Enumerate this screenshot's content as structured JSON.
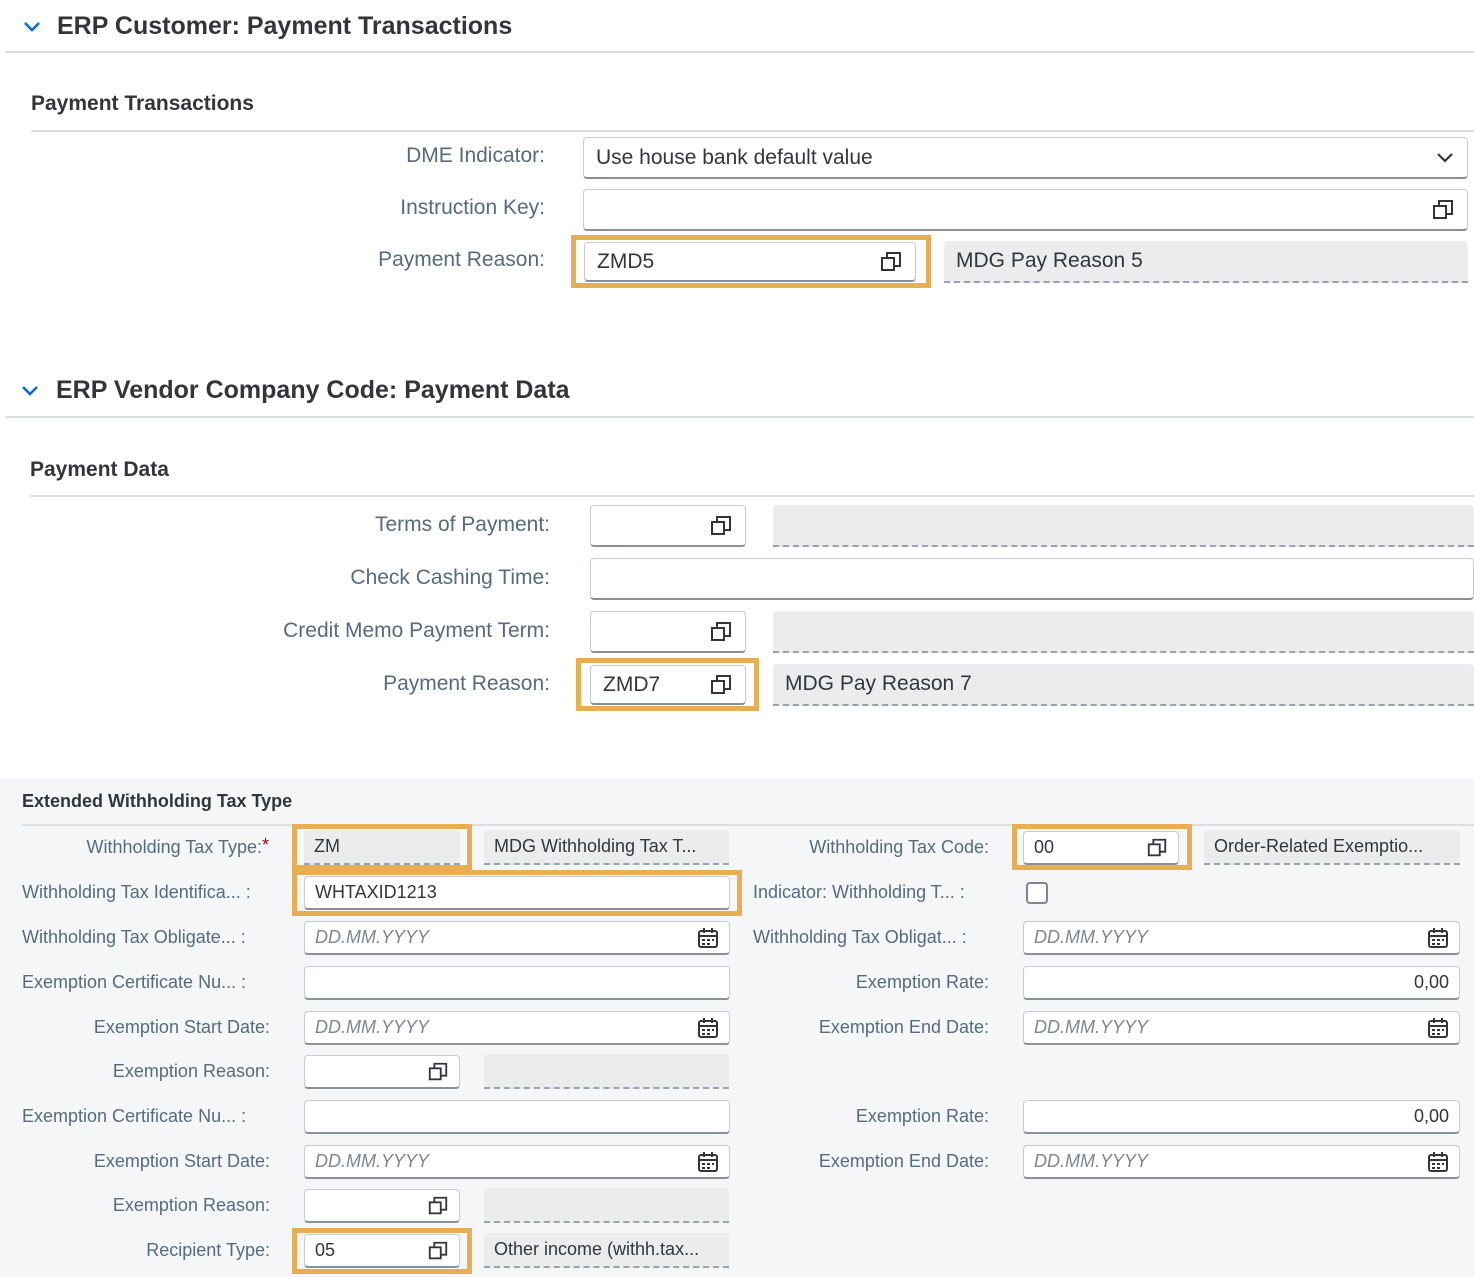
{
  "customer_panel": {
    "title": "ERP Customer: Payment Transactions",
    "section_title": "Payment Transactions",
    "dme_indicator": {
      "label": "DME Indicator:",
      "value": "Use house bank default value"
    },
    "instruction_key": {
      "label": "Instruction Key:",
      "value": ""
    },
    "payment_reason": {
      "label": "Payment Reason:",
      "value": "ZMD5",
      "description": "MDG Pay Reason 5"
    }
  },
  "vendor_panel": {
    "title": "ERP Vendor Company Code: Payment Data",
    "section_title": "Payment Data",
    "terms_of_payment": {
      "label": "Terms of Payment:",
      "value": "",
      "description": ""
    },
    "check_cashing_time": {
      "label": "Check Cashing Time:",
      "value": ""
    },
    "credit_memo_payment_term": {
      "label": "Credit Memo Payment Term:",
      "value": "",
      "description": ""
    },
    "payment_reason": {
      "label": "Payment Reason:",
      "value": "ZMD7",
      "description": "MDG Pay Reason 7"
    }
  },
  "withholding_section": {
    "title": "Extended Withholding Tax Type",
    "date_placeholder": "DD.MM.YYYY",
    "required_marker": "*",
    "tax_type": {
      "label": "Withholding Tax Type:",
      "value": "ZM",
      "description": "MDG Withholding Tax T..."
    },
    "tax_code": {
      "label": "Withholding Tax Code:",
      "value": "00",
      "description": "Order-Related Exemptio..."
    },
    "tax_identification": {
      "label": "Withholding Tax Identifica... :",
      "value": "WHTAXID1213"
    },
    "indicator_withholding": {
      "label": "Indicator: Withholding T... :",
      "checked": false
    },
    "obligated_from": {
      "label": "Withholding Tax Obligate... :"
    },
    "obligated_to": {
      "label": "Withholding Tax Obligat... :"
    },
    "exemptions": [
      {
        "certificate_label": "Exemption Certificate Nu... :",
        "certificate_value": "",
        "rate_label": "Exemption Rate:",
        "rate_value": "0,00",
        "start_label": "Exemption Start Date:",
        "end_label": "Exemption End Date:",
        "reason_label": "Exemption Reason:",
        "reason_value": "",
        "reason_description": ""
      },
      {
        "certificate_label": "Exemption Certificate Nu... :",
        "certificate_value": "",
        "rate_label": "Exemption Rate:",
        "rate_value": "0,00",
        "start_label": "Exemption Start Date:",
        "end_label": "Exemption End Date:",
        "reason_label": "Exemption Reason:",
        "reason_value": "",
        "reason_description": ""
      }
    ],
    "recipient_type": {
      "label": "Recipient Type:",
      "value": "05",
      "description": "Other income (withh.tax..."
    }
  },
  "colors": {
    "highlight": "#e8ae52",
    "accent": "#0a6ed1",
    "label": "#556b82",
    "text": "#32363a",
    "required": "#bb0000"
  },
  "icons": {
    "collapse": "chevron-down-icon",
    "value_help": "value-help-icon",
    "dropdown": "dropdown-arrow-icon",
    "date": "calendar-icon"
  }
}
